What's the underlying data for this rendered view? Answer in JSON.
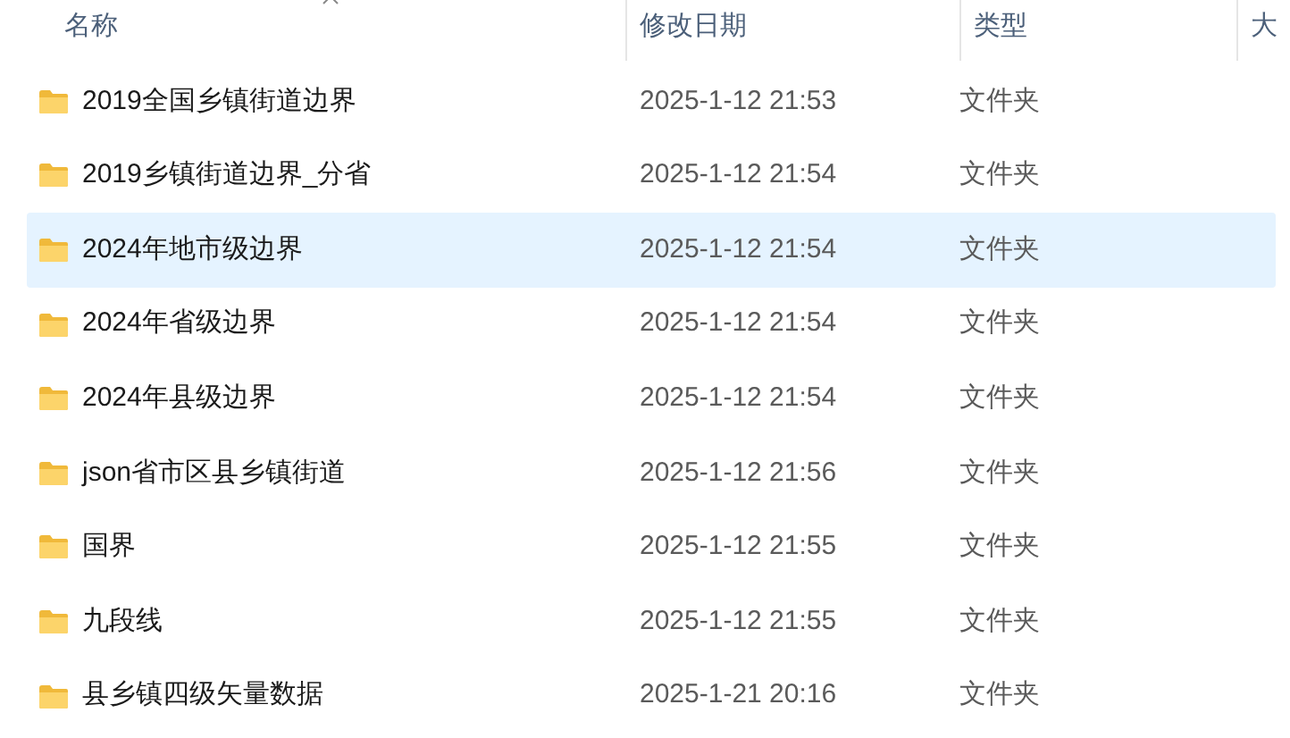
{
  "columns": [
    {
      "label": "名称",
      "sorted": true
    },
    {
      "label": "修改日期",
      "sorted": false
    },
    {
      "label": "类型",
      "sorted": false
    },
    {
      "label": "大",
      "sorted": false
    }
  ],
  "rows": [
    {
      "name": "2019全国乡镇街道边界",
      "modified": "2025-1-12 21:53",
      "type": "文件夹",
      "selected": false
    },
    {
      "name": "2019乡镇街道边界_分省",
      "modified": "2025-1-12 21:54",
      "type": "文件夹",
      "selected": false
    },
    {
      "name": "2024年地市级边界",
      "modified": "2025-1-12 21:54",
      "type": "文件夹",
      "selected": true
    },
    {
      "name": "2024年省级边界",
      "modified": "2025-1-12 21:54",
      "type": "文件夹",
      "selected": false
    },
    {
      "name": "2024年县级边界",
      "modified": "2025-1-12 21:54",
      "type": "文件夹",
      "selected": false
    },
    {
      "name": "json省市区县乡镇街道",
      "modified": "2025-1-12 21:56",
      "type": "文件夹",
      "selected": false
    },
    {
      "name": "国界",
      "modified": "2025-1-12 21:55",
      "type": "文件夹",
      "selected": false
    },
    {
      "name": "九段线",
      "modified": "2025-1-12 21:55",
      "type": "文件夹",
      "selected": false
    },
    {
      "name": "县乡镇四级矢量数据",
      "modified": "2025-1-21 20:16",
      "type": "文件夹",
      "selected": false
    }
  ]
}
